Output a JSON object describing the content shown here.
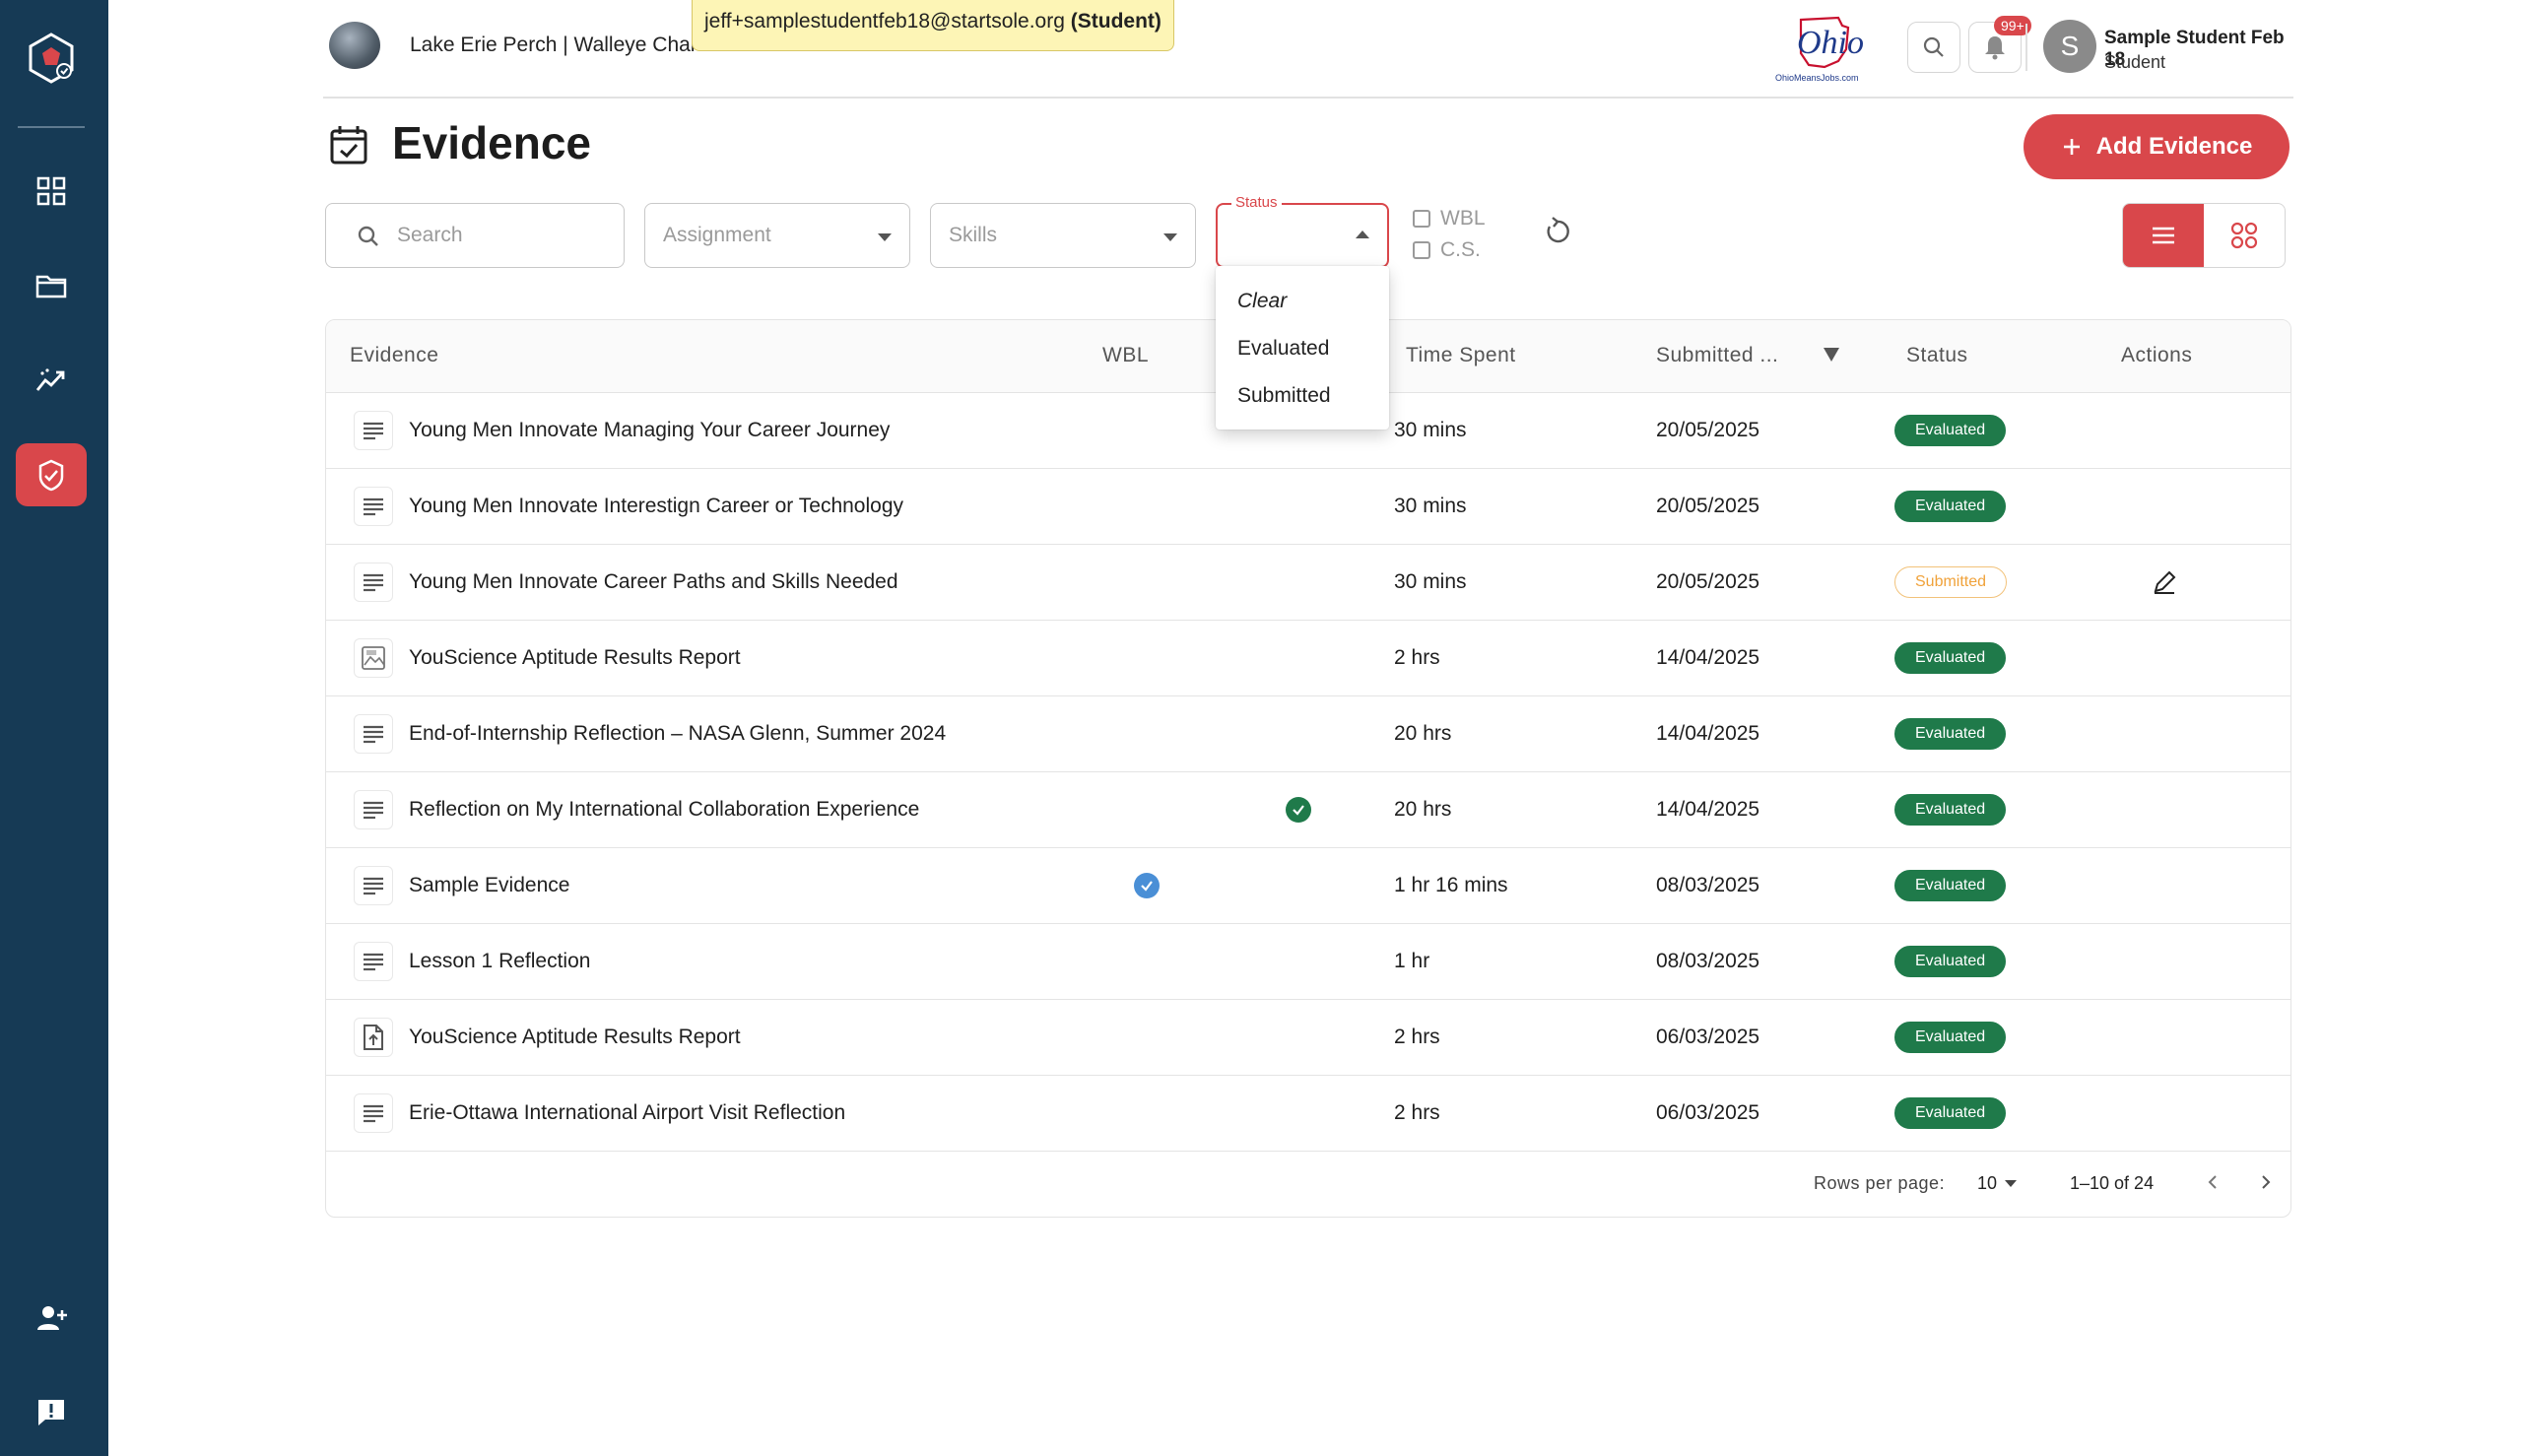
{
  "header": {
    "org_name": "Lake Erie Perch | Walleye Charters",
    "impersonation_email": "jeff+samplestudentfeb18@startsole.org",
    "impersonation_role": "(Student)",
    "logo_text": "Ohio",
    "logo_sub": "OhioMeansJobs.com",
    "notification_count": "99+",
    "user_initial": "S",
    "user_name": "Sample Student Feb 18",
    "user_role": "Student"
  },
  "page": {
    "title": "Evidence",
    "add_button": "Add Evidence"
  },
  "filters": {
    "search_placeholder": "Search",
    "assignment_placeholder": "Assignment",
    "skills_placeholder": "Skills",
    "status_label": "Status",
    "wbl_label": "WBL",
    "cs_label": "C.S."
  },
  "status_dropdown": {
    "options": [
      "Clear",
      "Evaluated",
      "Submitted"
    ]
  },
  "table": {
    "columns": {
      "evidence": "Evidence",
      "wbl": "WBL",
      "time_spent": "Time Spent",
      "submitted": "Submitted ...",
      "status": "Status",
      "actions": "Actions"
    },
    "rows": [
      {
        "icon": "text-lines-icon",
        "name": "Young Men Innovate Managing Your Career Journey",
        "wbl": "",
        "time": "30 mins",
        "date": "20/05/2025",
        "status": "Evaluated"
      },
      {
        "icon": "text-lines-icon",
        "name": "Young Men Innovate Interestign Career or Technology",
        "wbl": "",
        "time": "30 mins",
        "date": "20/05/2025",
        "status": "Evaluated"
      },
      {
        "icon": "text-lines-icon",
        "name": "Young Men Innovate Career Paths and Skills Needed",
        "wbl": "",
        "time": "30 mins",
        "date": "20/05/2025",
        "status": "Submitted"
      },
      {
        "icon": "image-icon",
        "name": "YouScience Aptitude Results Report",
        "wbl": "",
        "time": "2 hrs",
        "date": "14/04/2025",
        "status": "Evaluated"
      },
      {
        "icon": "text-lines-icon",
        "name": "End-of-Internship Reflection – NASA Glenn, Summer 2024",
        "wbl": "",
        "time": "20 hrs",
        "date": "14/04/2025",
        "status": "Evaluated"
      },
      {
        "icon": "text-lines-icon",
        "name": "Reflection on My International Collaboration Experience",
        "wbl": "cs-green",
        "time": "20 hrs",
        "date": "14/04/2025",
        "status": "Evaluated"
      },
      {
        "icon": "text-lines-icon",
        "name": "Sample Evidence",
        "wbl": "wbl-blue",
        "time": "1 hr 16 mins",
        "date": "08/03/2025",
        "status": "Evaluated"
      },
      {
        "icon": "text-lines-icon",
        "name": "Lesson 1 Reflection",
        "wbl": "",
        "time": "1 hr",
        "date": "08/03/2025",
        "status": "Evaluated"
      },
      {
        "icon": "file-upload-icon",
        "name": "YouScience Aptitude Results Report",
        "wbl": "",
        "time": "2 hrs",
        "date": "06/03/2025",
        "status": "Evaluated"
      },
      {
        "icon": "text-lines-icon",
        "name": "Erie-Ottawa International Airport Visit Reflection",
        "wbl": "",
        "time": "2 hrs",
        "date": "06/03/2025",
        "status": "Evaluated"
      }
    ]
  },
  "pagination": {
    "rows_per_page_label": "Rows per page:",
    "rows_per_page": "10",
    "range": "1–10 of 24"
  },
  "colors": {
    "sidebar": "#163a55",
    "accent": "#d9474b",
    "evaluated": "#1f7a4a",
    "submitted": "#f0a23a"
  }
}
